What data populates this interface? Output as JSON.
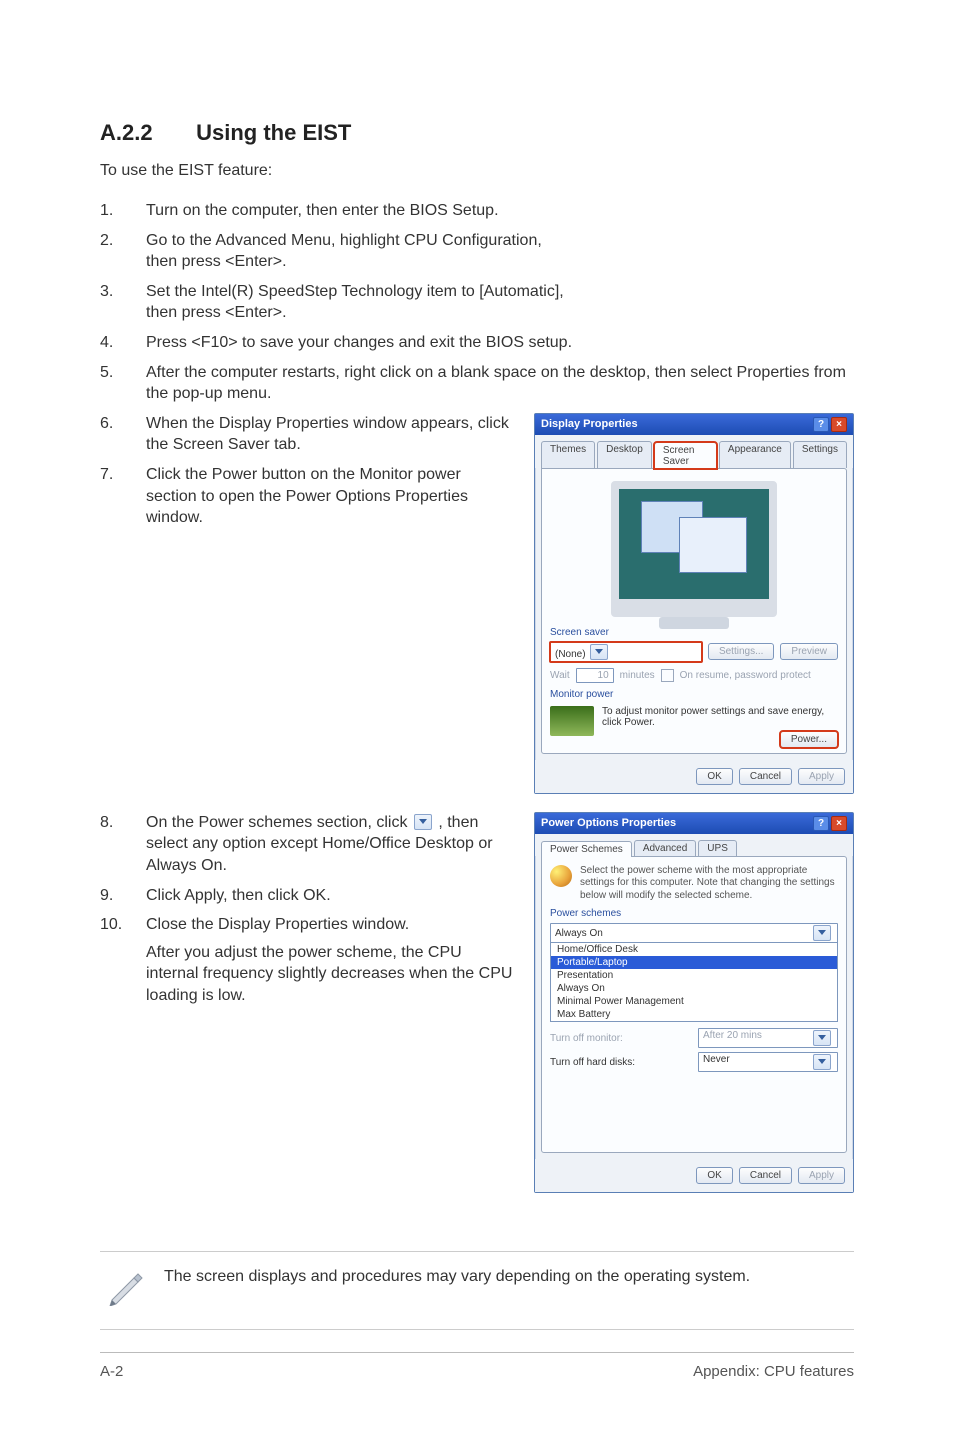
{
  "heading": {
    "number": "A.2.2",
    "title": "Using the EIST"
  },
  "lead": "To use the EIST feature:",
  "steps": {
    "s1": "Turn on the computer, then enter the BIOS Setup.",
    "s2a": "Go to the Advanced Menu, highlight CPU Configuration,",
    "s2b": "then press <Enter>.",
    "s3a": "Set the Intel(R) SpeedStep Technology item to [Automatic],",
    "s3b": "then press <Enter>.",
    "s4": "Press <F10> to save your changes and exit the BIOS setup.",
    "s5": "After the computer restarts, right click on a blank space on the desktop, then select Properties from the pop-up menu.",
    "s6": "When the Display Properties window appears, click the Screen Saver tab.",
    "s7": "Click the Power button on the Monitor power section to open the Power Options Properties window.",
    "s8a": "On the Power schemes section, click ",
    "s8b": ", then select any option except Home/Office Desktop or Always On.",
    "s9": "Click Apply, then click OK.",
    "s10": "Close the Display Properties window.",
    "s10_after": "After you adjust the power scheme, the CPU internal frequency slightly decreases when the CPU loading is low."
  },
  "display_dialog": {
    "title": "Display Properties",
    "tabs": {
      "t0": "Themes",
      "t1": "Desktop",
      "t2": "Screen Saver",
      "t3": "Appearance",
      "t4": "Settings"
    },
    "section_ss": "Screen saver",
    "ss_value": "(None)",
    "btn_settings": "Settings...",
    "btn_preview": "Preview",
    "wait_label": "Wait",
    "wait_value": "10",
    "wait_unit": "minutes",
    "wait_chk": "On resume, password protect",
    "section_mp": "Monitor power",
    "mp_text": "To adjust monitor power settings and save energy, click Power.",
    "btn_power": "Power...",
    "btn_ok": "OK",
    "btn_cancel": "Cancel",
    "btn_apply": "Apply"
  },
  "power_dialog": {
    "title": "Power Options Properties",
    "tabs": {
      "t0": "Power Schemes",
      "t1": "Advanced",
      "t2": "UPS"
    },
    "desc": "Select the power scheme with the most appropriate settings for this computer. Note that changing the settings below will modify the selected scheme.",
    "section_ps": "Power schemes",
    "selected": "Always On",
    "options": {
      "o0": "Home/Office Desk",
      "o1": "Portable/Laptop",
      "o2": "Presentation",
      "o3": "Always On",
      "o4": "Minimal Power Management",
      "o5": "Max Battery"
    },
    "row_monitor_label": "Turn off monitor:",
    "row_monitor_value": "After 20 mins",
    "row_hdd_label": "Turn off hard disks:",
    "row_hdd_value": "Never",
    "btn_ok": "OK",
    "btn_cancel": "Cancel",
    "btn_apply": "Apply"
  },
  "note": "The screen displays and procedures may vary depending on the operating system.",
  "footer": {
    "left": "A-2",
    "right": "Appendix: CPU features"
  }
}
